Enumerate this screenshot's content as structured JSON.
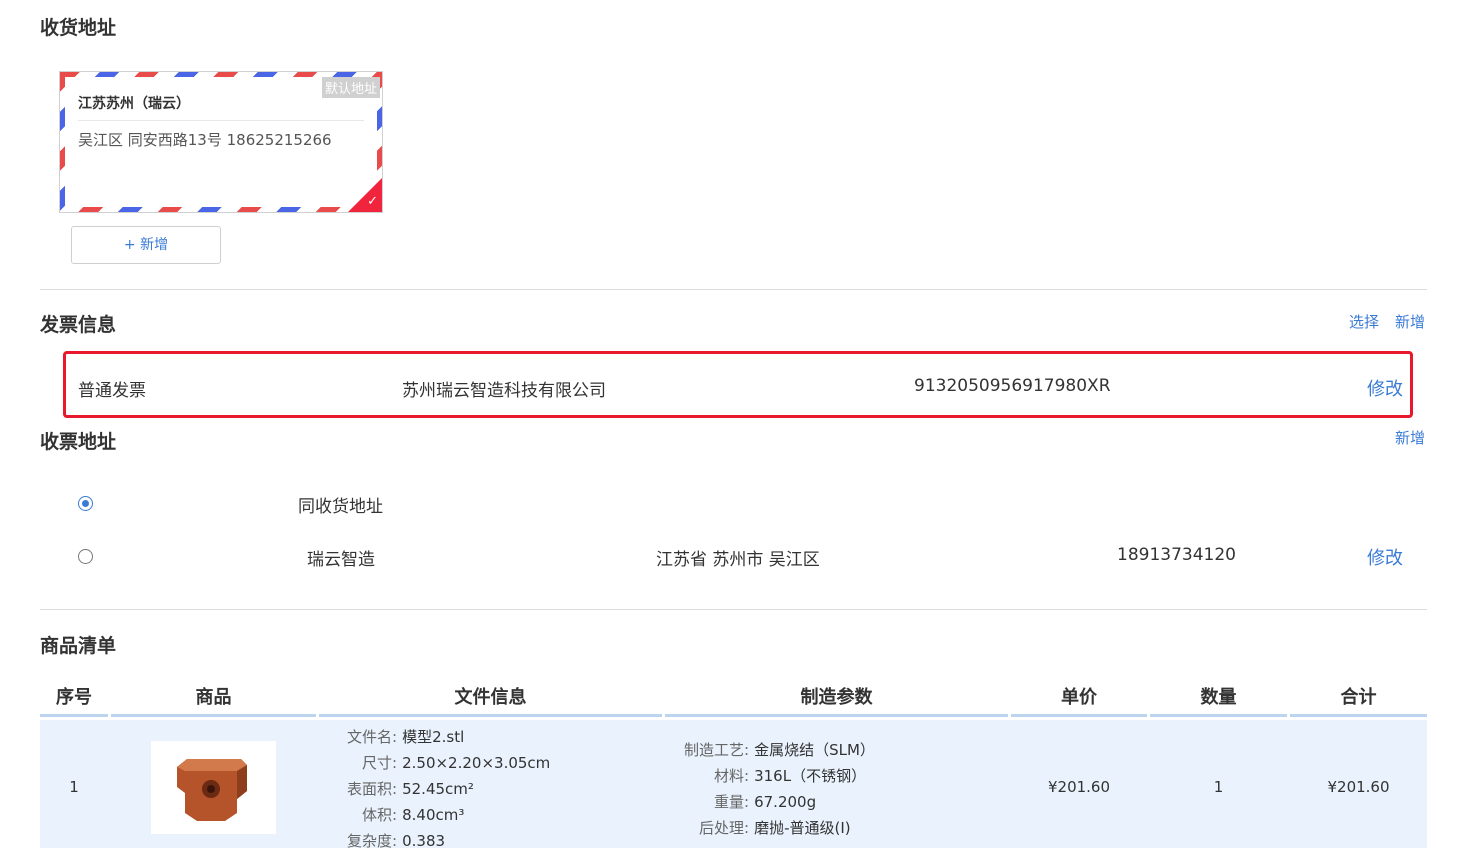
{
  "shipping": {
    "title": "收货地址",
    "card": {
      "name": "江苏苏州（瑞云）",
      "detail": "吴江区 同安西路13号 18625215266",
      "default_tag": "默认地址"
    },
    "add_button": "+ 新增"
  },
  "invoice": {
    "title": "发票信息",
    "select_link": "选择",
    "add_link": "新增",
    "row": {
      "type": "普通发票",
      "company": "苏州瑞云智造科技有限公司",
      "tax_id": "9132050956917980XR",
      "edit_link": "修改"
    }
  },
  "invoice_address": {
    "title": "收票地址",
    "add_link": "新增",
    "options": [
      {
        "label": "同收货地址",
        "checked": true
      },
      {
        "name": "瑞云智造",
        "region": "江苏省 苏州市 吴江区",
        "phone": "18913734120",
        "edit_link": "修改",
        "checked": false
      }
    ]
  },
  "products": {
    "title": "商品清单",
    "columns": [
      "序号",
      "商品",
      "文件信息",
      "制造参数",
      "单价",
      "数量",
      "合计"
    ],
    "rows": [
      {
        "index": "1",
        "file_info": [
          {
            "label": "文件名:",
            "value": "模型2.stl"
          },
          {
            "label": "尺寸:",
            "value": "2.50×2.20×3.05cm"
          },
          {
            "label": "表面积:",
            "value": "52.45cm²"
          },
          {
            "label": "体积:",
            "value": "8.40cm³"
          },
          {
            "label": "复杂度:",
            "value": "0.383"
          }
        ],
        "params": [
          {
            "label": "制造工艺:",
            "value": "金属烧结（SLM）"
          },
          {
            "label": "材料:",
            "value": "316L（不锈钢）"
          },
          {
            "label": "重量:",
            "value": "67.200g"
          },
          {
            "label": "后处理:",
            "value": "磨抛-普通级(I)"
          }
        ],
        "unit_price": "¥201.60",
        "quantity": "1",
        "total": "¥201.60"
      }
    ]
  },
  "colors": {
    "accent": "#3a7bd5",
    "highlight_border": "#e8192c",
    "check_corner": "#f0243c",
    "table_row_bg": "#eaf3fd",
    "product_color": "#b5532a"
  },
  "icons": [
    "check-icon",
    "radio-icon",
    "product-thumbnail"
  ]
}
